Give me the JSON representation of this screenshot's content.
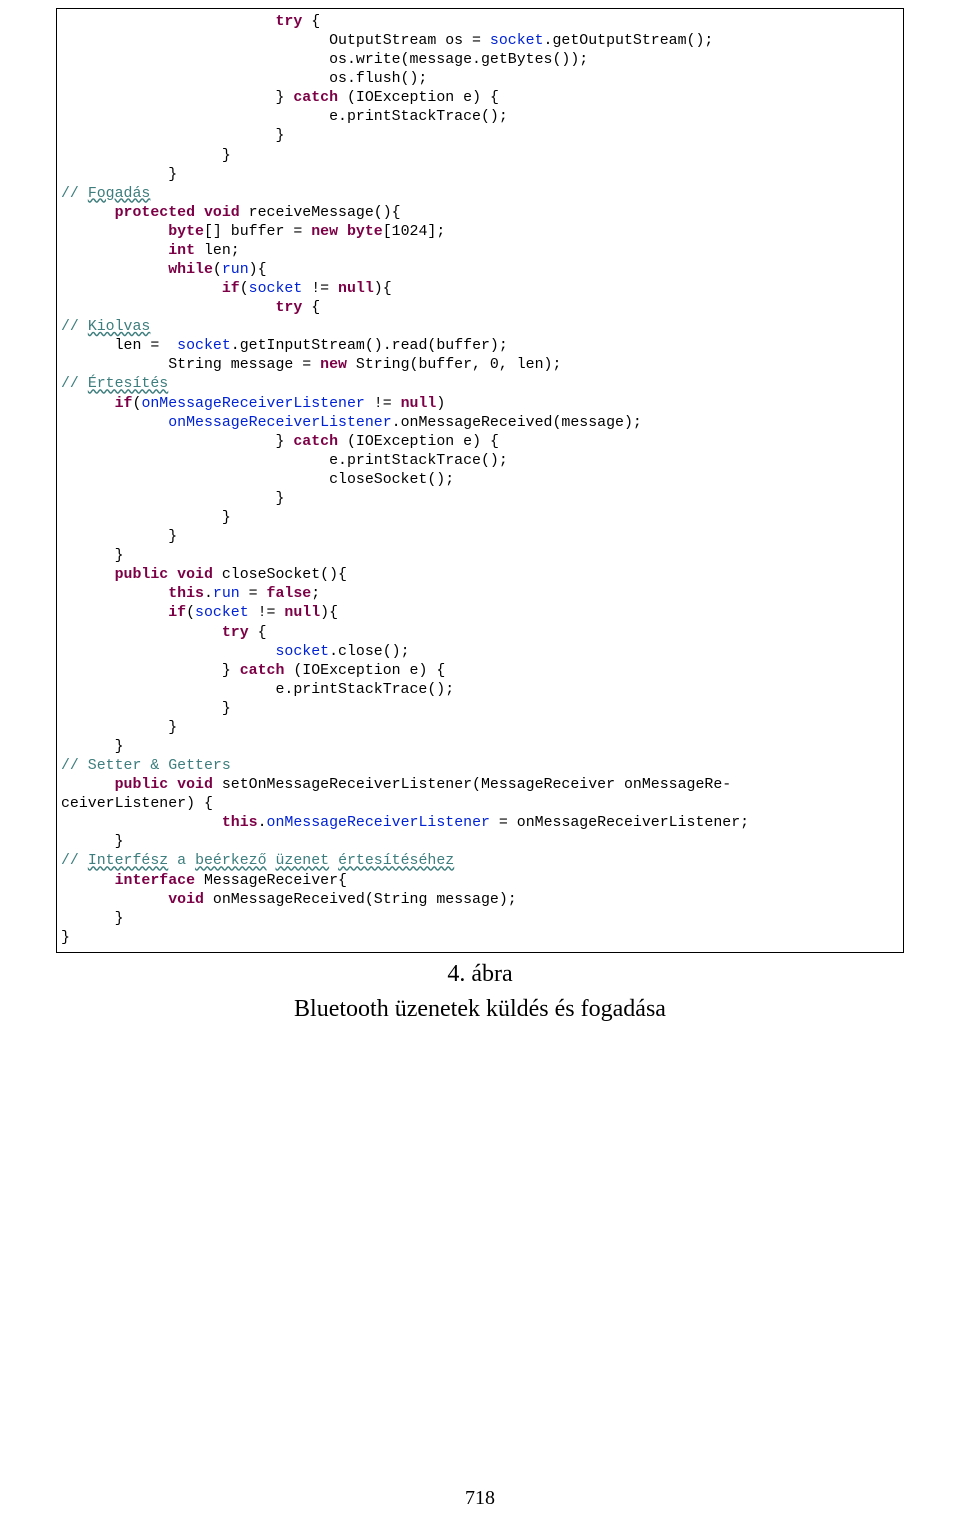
{
  "code_lines": [
    [
      {
        "cls": "plain",
        "txt": "                        "
      },
      {
        "cls": "kw",
        "txt": "try"
      },
      {
        "cls": "plain",
        "txt": " {"
      }
    ],
    [
      {
        "cls": "plain",
        "txt": "                              OutputStream os = "
      },
      {
        "cls": "blue",
        "txt": "socket"
      },
      {
        "cls": "plain",
        "txt": ".getOutputStream();"
      }
    ],
    [
      {
        "cls": "plain",
        "txt": "                              os.write(message.getBytes());"
      }
    ],
    [
      {
        "cls": "plain",
        "txt": "                              os.flush();"
      }
    ],
    [
      {
        "cls": "plain",
        "txt": "                        } "
      },
      {
        "cls": "kw",
        "txt": "catch"
      },
      {
        "cls": "plain",
        "txt": " (IOException e) {"
      }
    ],
    [
      {
        "cls": "plain",
        "txt": "                              e.printStackTrace();"
      }
    ],
    [
      {
        "cls": "plain",
        "txt": "                        }"
      }
    ],
    [
      {
        "cls": "plain",
        "txt": "                  }"
      }
    ],
    [
      {
        "cls": "plain",
        "txt": "            }"
      }
    ],
    [
      {
        "cls": "comment",
        "txt": "// "
      },
      {
        "cls": "comment uline",
        "txt": "Fogadás"
      }
    ],
    [
      {
        "cls": "plain",
        "txt": "      "
      },
      {
        "cls": "kw",
        "txt": "protected void"
      },
      {
        "cls": "plain",
        "txt": " receiveMessage(){"
      }
    ],
    [
      {
        "cls": "plain",
        "txt": "            "
      },
      {
        "cls": "kw",
        "txt": "byte"
      },
      {
        "cls": "plain",
        "txt": "[] buffer = "
      },
      {
        "cls": "kw",
        "txt": "new byte"
      },
      {
        "cls": "plain",
        "txt": "[1024];"
      }
    ],
    [
      {
        "cls": "plain",
        "txt": "            "
      },
      {
        "cls": "kw",
        "txt": "int"
      },
      {
        "cls": "plain",
        "txt": " len;"
      }
    ],
    [
      {
        "cls": "plain",
        "txt": "            "
      },
      {
        "cls": "kw",
        "txt": "while"
      },
      {
        "cls": "plain",
        "txt": "("
      },
      {
        "cls": "blue",
        "txt": "run"
      },
      {
        "cls": "plain",
        "txt": "){"
      }
    ],
    [
      {
        "cls": "plain",
        "txt": "                  "
      },
      {
        "cls": "kw",
        "txt": "if"
      },
      {
        "cls": "plain",
        "txt": "("
      },
      {
        "cls": "blue",
        "txt": "socket"
      },
      {
        "cls": "plain",
        "txt": " != "
      },
      {
        "cls": "kw",
        "txt": "null"
      },
      {
        "cls": "plain",
        "txt": "){"
      }
    ],
    [
      {
        "cls": "plain",
        "txt": "                        "
      },
      {
        "cls": "kw",
        "txt": "try"
      },
      {
        "cls": "plain",
        "txt": " {"
      }
    ],
    [
      {
        "cls": "comment",
        "txt": "// "
      },
      {
        "cls": "comment uline",
        "txt": "Kiolvas"
      }
    ],
    [
      {
        "cls": "plain",
        "txt": "      len =  "
      },
      {
        "cls": "blue",
        "txt": "socket"
      },
      {
        "cls": "plain",
        "txt": ".getInputStream().read(buffer);"
      }
    ],
    [
      {
        "cls": "plain",
        "txt": "            String message = "
      },
      {
        "cls": "kw",
        "txt": "new"
      },
      {
        "cls": "plain",
        "txt": " String(buffer, 0, len);"
      }
    ],
    [
      {
        "cls": "comment",
        "txt": "// "
      },
      {
        "cls": "comment uline",
        "txt": "Értesítés"
      }
    ],
    [
      {
        "cls": "plain",
        "txt": "      "
      },
      {
        "cls": "kw",
        "txt": "if"
      },
      {
        "cls": "plain",
        "txt": "("
      },
      {
        "cls": "blue",
        "txt": "onMessageReceiverListener"
      },
      {
        "cls": "plain",
        "txt": " != "
      },
      {
        "cls": "kw",
        "txt": "null"
      },
      {
        "cls": "plain",
        "txt": ")"
      }
    ],
    [
      {
        "cls": "plain",
        "txt": "            "
      },
      {
        "cls": "blue",
        "txt": "onMessageReceiverListener"
      },
      {
        "cls": "plain",
        "txt": ".onMessageReceived(message);"
      }
    ],
    [
      {
        "cls": "plain",
        "txt": "                        } "
      },
      {
        "cls": "kw",
        "txt": "catch"
      },
      {
        "cls": "plain",
        "txt": " (IOException e) {"
      }
    ],
    [
      {
        "cls": "plain",
        "txt": "                              e.printStackTrace();"
      }
    ],
    [
      {
        "cls": "plain",
        "txt": "                              closeSocket();"
      }
    ],
    [
      {
        "cls": "plain",
        "txt": "                        }"
      }
    ],
    [
      {
        "cls": "plain",
        "txt": "                  }"
      }
    ],
    [
      {
        "cls": "plain",
        "txt": "            }"
      }
    ],
    [
      {
        "cls": "plain",
        "txt": "      }"
      }
    ],
    [
      {
        "cls": "plain",
        "txt": "      "
      },
      {
        "cls": "kw",
        "txt": "public void"
      },
      {
        "cls": "plain",
        "txt": " closeSocket(){"
      }
    ],
    [
      {
        "cls": "plain",
        "txt": "            "
      },
      {
        "cls": "kw",
        "txt": "this"
      },
      {
        "cls": "plain",
        "txt": "."
      },
      {
        "cls": "blue",
        "txt": "run"
      },
      {
        "cls": "plain",
        "txt": " = "
      },
      {
        "cls": "kw",
        "txt": "false"
      },
      {
        "cls": "plain",
        "txt": ";"
      }
    ],
    [
      {
        "cls": "plain",
        "txt": "            "
      },
      {
        "cls": "kw",
        "txt": "if"
      },
      {
        "cls": "plain",
        "txt": "("
      },
      {
        "cls": "blue",
        "txt": "socket"
      },
      {
        "cls": "plain",
        "txt": " != "
      },
      {
        "cls": "kw",
        "txt": "null"
      },
      {
        "cls": "plain",
        "txt": "){"
      }
    ],
    [
      {
        "cls": "plain",
        "txt": "                  "
      },
      {
        "cls": "kw",
        "txt": "try"
      },
      {
        "cls": "plain",
        "txt": " {"
      }
    ],
    [
      {
        "cls": "plain",
        "txt": "                        "
      },
      {
        "cls": "blue",
        "txt": "socket"
      },
      {
        "cls": "plain",
        "txt": ".close();"
      }
    ],
    [
      {
        "cls": "plain",
        "txt": "                  } "
      },
      {
        "cls": "kw",
        "txt": "catch"
      },
      {
        "cls": "plain",
        "txt": " (IOException e) {"
      }
    ],
    [
      {
        "cls": "plain",
        "txt": "                        e.printStackTrace();"
      }
    ],
    [
      {
        "cls": "plain",
        "txt": "                  }"
      }
    ],
    [
      {
        "cls": "plain",
        "txt": "            }"
      }
    ],
    [
      {
        "cls": "plain",
        "txt": "      }"
      }
    ],
    [
      {
        "cls": "comment",
        "txt": "// Setter & Getters"
      }
    ],
    [
      {
        "cls": "plain",
        "txt": "      "
      },
      {
        "cls": "kw",
        "txt": "public void"
      },
      {
        "cls": "plain",
        "txt": " setOnMessageReceiverListener(MessageReceiver onMessageRe-"
      }
    ],
    [
      {
        "cls": "plain",
        "txt": "ceiverListener) {"
      }
    ],
    [
      {
        "cls": "plain",
        "txt": "                  "
      },
      {
        "cls": "kw",
        "txt": "this"
      },
      {
        "cls": "plain",
        "txt": "."
      },
      {
        "cls": "blue",
        "txt": "onMessageReceiverListener"
      },
      {
        "cls": "plain",
        "txt": " = onMessageReceiverListener;"
      }
    ],
    [
      {
        "cls": "plain",
        "txt": "      }"
      }
    ],
    [
      {
        "cls": "comment",
        "txt": "// "
      },
      {
        "cls": "comment uline",
        "txt": "Interfész"
      },
      {
        "cls": "comment",
        "txt": " a "
      },
      {
        "cls": "comment uline",
        "txt": "beérkező"
      },
      {
        "cls": "comment",
        "txt": " "
      },
      {
        "cls": "comment uline",
        "txt": "üzenet"
      },
      {
        "cls": "comment",
        "txt": " "
      },
      {
        "cls": "comment uline",
        "txt": "értesítéséhez"
      }
    ],
    [
      {
        "cls": "plain",
        "txt": "      "
      },
      {
        "cls": "kw",
        "txt": "interface"
      },
      {
        "cls": "plain",
        "txt": " MessageReceiver{"
      }
    ],
    [
      {
        "cls": "plain",
        "txt": "            "
      },
      {
        "cls": "kw",
        "txt": "void"
      },
      {
        "cls": "plain",
        "txt": " onMessageReceived(String message);"
      }
    ],
    [
      {
        "cls": "plain",
        "txt": "      }"
      }
    ],
    [
      {
        "cls": "plain",
        "txt": "}"
      }
    ]
  ],
  "caption": {
    "line1": "4. ábra",
    "line2": "Bluetooth üzenetek küldés és fogadása"
  },
  "page_number": "718"
}
